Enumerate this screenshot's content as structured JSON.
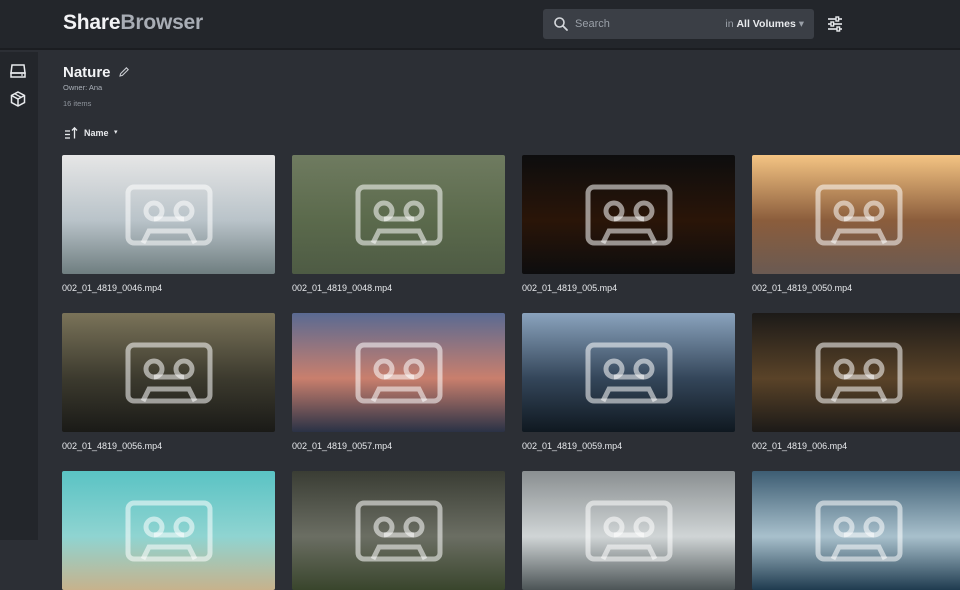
{
  "app": {
    "brand_part1": "Share",
    "brand_part2": "Browser"
  },
  "search": {
    "placeholder": "Search",
    "scope_prefix": "in",
    "scope_value": "All Volumes",
    "caret": "▾"
  },
  "sidebar": {
    "items": [
      {
        "icon": "drive-icon"
      },
      {
        "icon": "cube-icon"
      }
    ]
  },
  "collection": {
    "title": "Nature",
    "owner": "Owner: Ana",
    "count": "16 items"
  },
  "sort": {
    "label": "Name",
    "caret": "▾"
  },
  "files": [
    {
      "name": "002_01_4819_0046.mp4",
      "colors": [
        "#e6e6e6",
        "#b9c3c9",
        "#6f7e80"
      ]
    },
    {
      "name": "002_01_4819_0048.mp4",
      "colors": [
        "#6f7b60",
        "#5b6a4c",
        "#4e5b44"
      ]
    },
    {
      "name": "002_01_4819_005.mp4",
      "colors": [
        "#0d0d0e",
        "#2a1508",
        "#0d0d0e"
      ]
    },
    {
      "name": "002_01_4819_0050.mp4",
      "colors": [
        "#f4c483",
        "#8b5d3c",
        "#6a5a52"
      ]
    },
    {
      "name": "002_01_4819_0056.mp4",
      "colors": [
        "#7a7359",
        "#3c3a2e",
        "#1a1a17"
      ]
    },
    {
      "name": "002_01_4819_0057.mp4",
      "colors": [
        "#5a6a92",
        "#c97f6d",
        "#2a3246"
      ]
    },
    {
      "name": "002_01_4819_0059.mp4",
      "colors": [
        "#8aa3bd",
        "#34465a",
        "#0f1820"
      ]
    },
    {
      "name": "002_01_4819_006.mp4",
      "colors": [
        "#1c1a18",
        "#5a4328",
        "#1c1a18"
      ]
    },
    {
      "name": "",
      "colors": [
        "#5ac3c4",
        "#8fd4d1",
        "#c7b28c"
      ]
    },
    {
      "name": "",
      "colors": [
        "#3a3d34",
        "#6b6e63",
        "#39452c"
      ]
    },
    {
      "name": "",
      "colors": [
        "#8a8f91",
        "#d0d5d6",
        "#4c5456"
      ]
    },
    {
      "name": "",
      "colors": [
        "#3d5d73",
        "#a8c0cc",
        "#1f3b4f"
      ]
    }
  ]
}
